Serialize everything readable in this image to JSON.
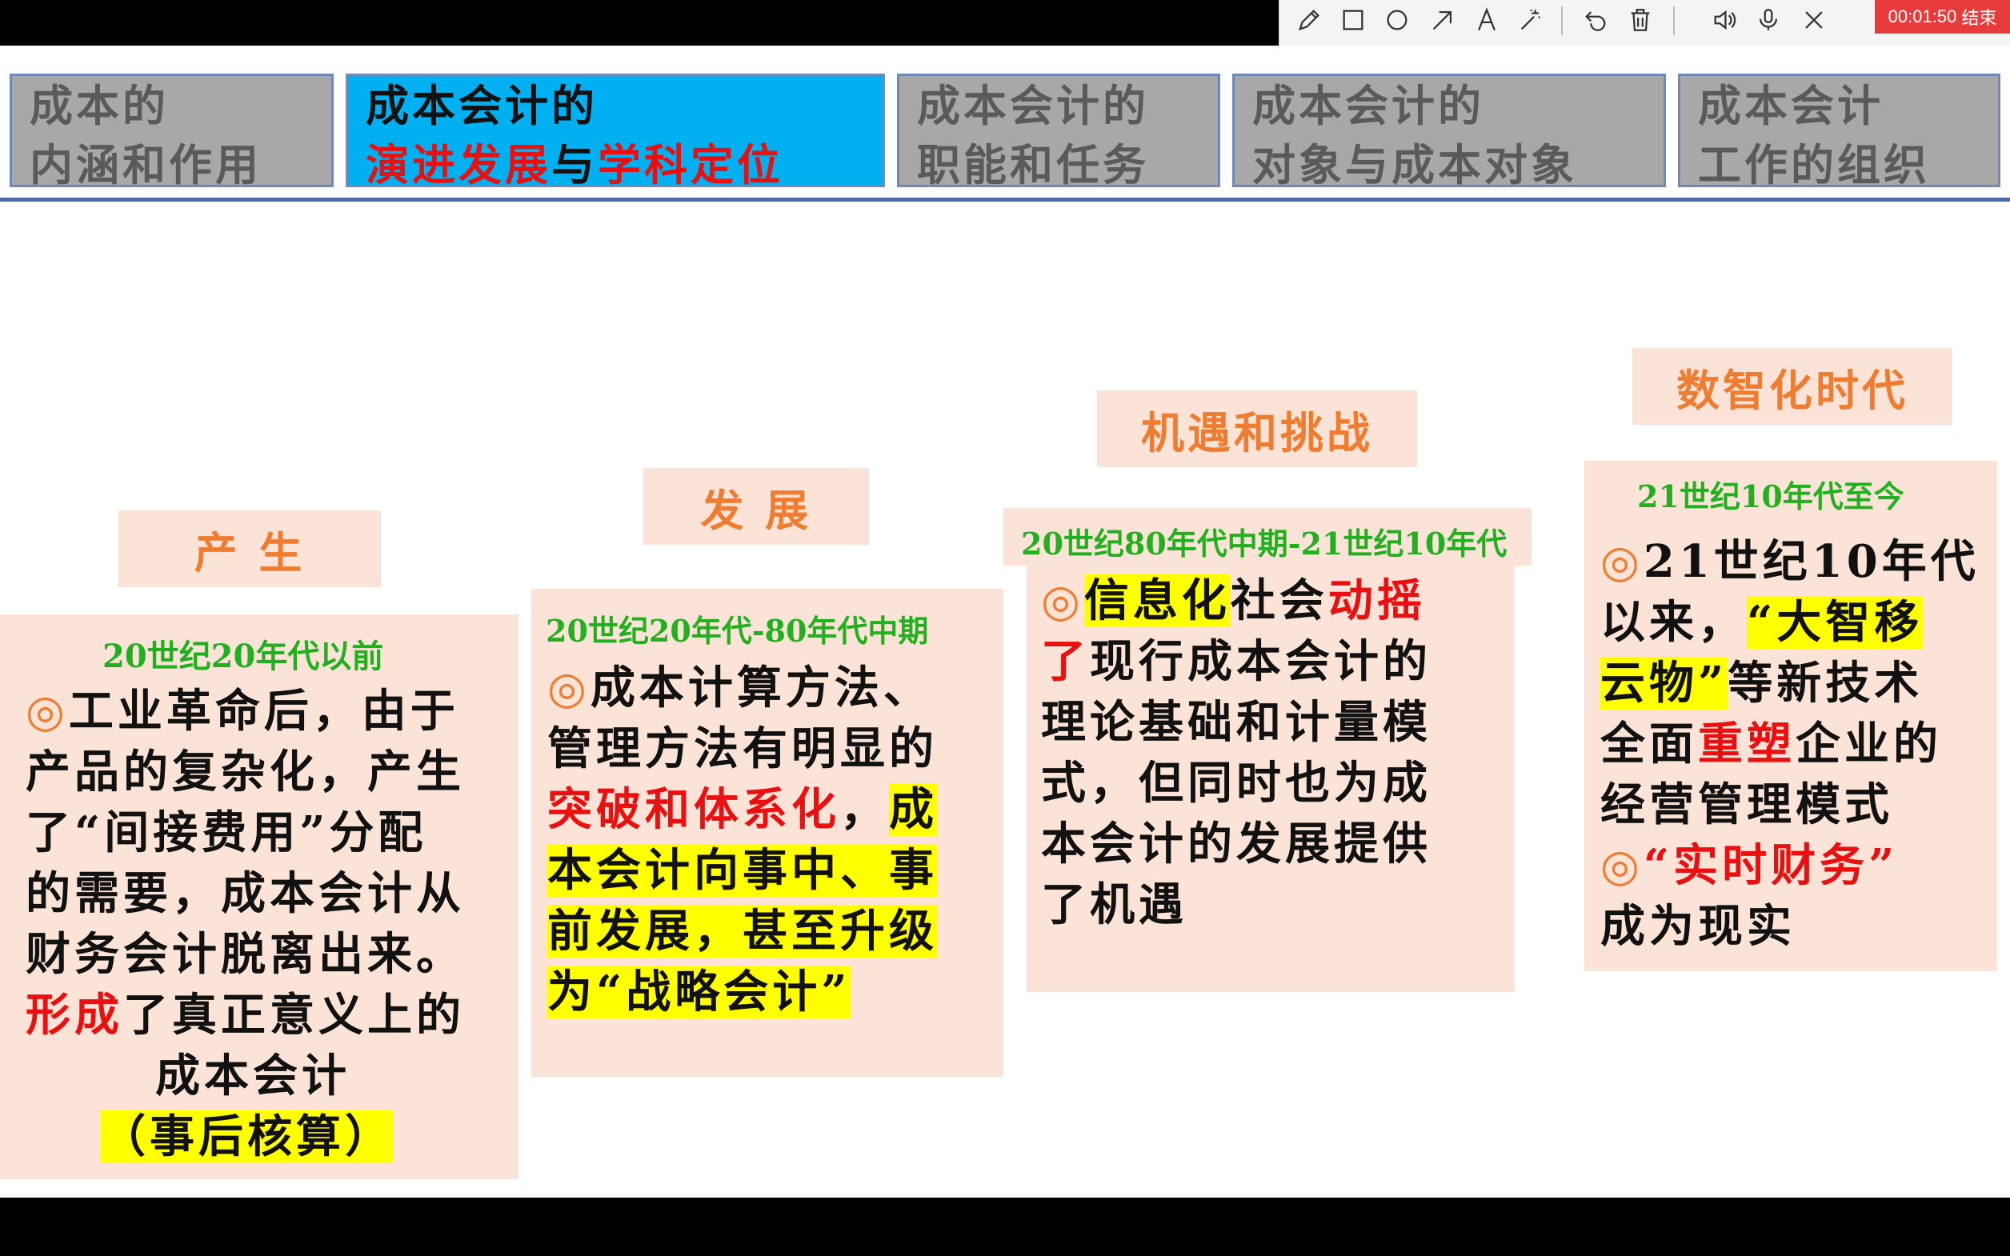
{
  "toolbar": {
    "tools": [
      "pencil-icon",
      "rectangle-icon",
      "circle-icon",
      "arrow-icon",
      "text-icon",
      "magic-wand-icon",
      "undo-icon",
      "trash-icon",
      "speaker-icon",
      "microphone-icon",
      "close-icon"
    ],
    "timer": "00:01:50",
    "end_label": "结束"
  },
  "tabs": [
    {
      "line1": "成本的",
      "line2": "内涵和作用"
    },
    {
      "line1": "成本会计的",
      "line2a": "演进发展",
      "line2b": "与",
      "line2c": "学科定位"
    },
    {
      "line1": "成本会计的",
      "line2": "职能和任务"
    },
    {
      "line1": "成本会计的",
      "line2": "对象与成本对象"
    },
    {
      "line1": "成本会计",
      "line2": "工作的组织"
    }
  ],
  "stages": [
    {
      "heading": "产    生",
      "period": "20世纪20年代以前",
      "l1a": "◎",
      "l1b": "工业革命后，由于",
      "l2": "产品的复杂化，产生",
      "l3": "了“间接费用”分配",
      "l4": "的需要，成本会计从",
      "l5": "财务会计脱离出来。",
      "l6a": "形成",
      "l6b": "了真正意义上的",
      "l7": "成本会计",
      "l8": "（事后核算）"
    },
    {
      "heading": "发    展",
      "period": "20世纪20年代-80年代中期",
      "l1a": "◎",
      "l1b": "成本计算方法、",
      "l2": "管理方法有明显的",
      "l3a": "突破和体系化",
      "l3b": "，",
      "l3c": "成",
      "l4": "本会计向事中、事",
      "l5": "前发展，甚至升级",
      "l6": "为“战略会计”"
    },
    {
      "heading": "机遇和挑战",
      "period": "20世纪80年代中期-21世纪10年代",
      "l1a": "◎",
      "l1b": "信息化",
      "l1c": "社会",
      "l1d": "动摇",
      "l2a": "了",
      "l2b": "现行成本会计的",
      "l3": "理论基础和计量模",
      "l4": "式，但同时也为成",
      "l5": "本会计的发展提供",
      "l6": "了机遇"
    },
    {
      "heading": "数智化时代",
      "period": "21世纪10年代至今",
      "l1a": "◎",
      "l1b": "21世纪10年代",
      "l2a": "以来，",
      "l2b": "“大智移",
      "l3a": "云物”",
      "l3b": "等新技术",
      "l4a": "全面",
      "l4b": "重塑",
      "l4c": "企业的",
      "l5": "经营管理模式",
      "l6a": "◎",
      "l6b": "“实时财务”",
      "l7": "成为现实"
    }
  ]
}
